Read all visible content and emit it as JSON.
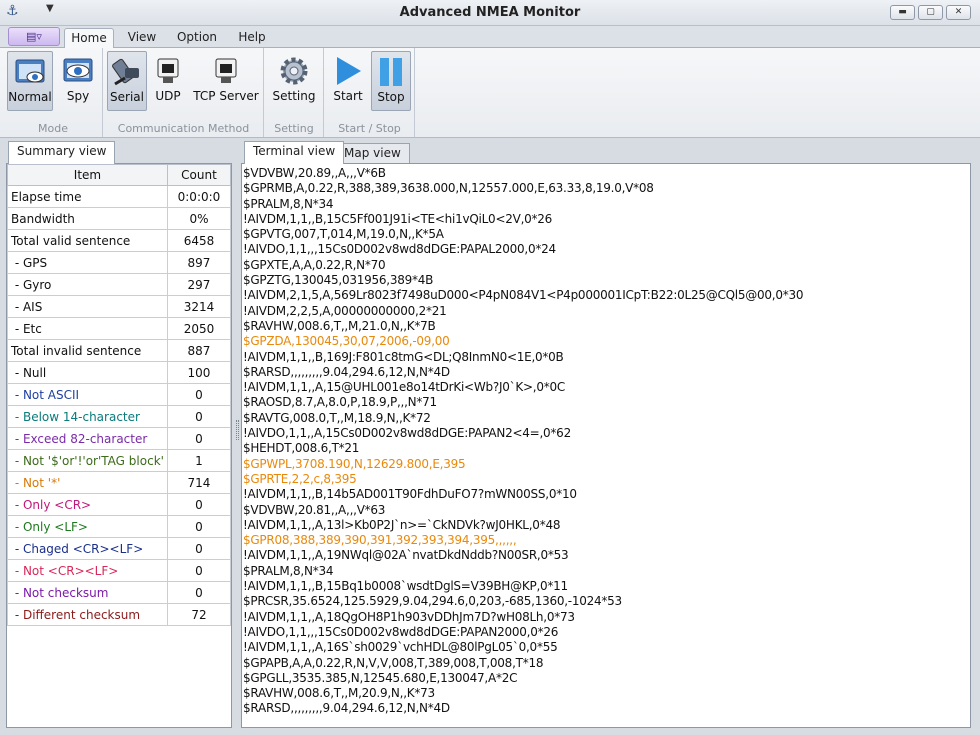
{
  "window": {
    "title": "Advanced NMEA Monitor",
    "icon": "anchor-icon",
    "controls": {
      "minimize": "▬",
      "maximize": "▢",
      "close": "✕"
    }
  },
  "menu_tabs": [
    "Home",
    "View",
    "Option",
    "Help"
  ],
  "ribbon": {
    "groups": [
      {
        "title": "Mode",
        "buttons": [
          "Normal",
          "Spy"
        ]
      },
      {
        "title": "Communication Method",
        "buttons": [
          "Serial",
          "UDP",
          "TCP Server"
        ]
      },
      {
        "title": "Setting",
        "buttons": [
          "Setting"
        ]
      },
      {
        "title": "Start / Stop",
        "buttons": [
          "Start",
          "Stop"
        ]
      }
    ]
  },
  "summary": {
    "tab_label": "Summary view",
    "headers": [
      "Item",
      "Count"
    ],
    "rows": [
      {
        "item": "Elapse time",
        "count": "0:0:0:0",
        "color": "#111111"
      },
      {
        "item": "Bandwidth",
        "count": "0%",
        "color": "#111111"
      },
      {
        "item": "Total valid sentence",
        "count": "6458",
        "color": "#111111"
      },
      {
        "item": " - GPS",
        "count": "897",
        "color": "#111111"
      },
      {
        "item": " - Gyro",
        "count": "297",
        "color": "#111111"
      },
      {
        "item": " - AIS",
        "count": "3214",
        "color": "#111111"
      },
      {
        "item": " - Etc",
        "count": "2050",
        "color": "#111111"
      },
      {
        "item": "Total invalid sentence",
        "count": "887",
        "color": "#111111"
      },
      {
        "item": " - Null",
        "count": "100",
        "color": "#111111"
      },
      {
        "item": " - Not ASCII",
        "count": "0",
        "color": "#1f3fa0"
      },
      {
        "item": " - Below 14-character",
        "count": "0",
        "color": "#0a7b7b"
      },
      {
        "item": " - Exceed 82-character",
        "count": "0",
        "color": "#7a2aa8"
      },
      {
        "item": " - Not '$'or'!'or'TAG block'",
        "count": "1",
        "color": "#3c6b1a"
      },
      {
        "item": " - Not '*'",
        "count": "714",
        "color": "#d47a0a"
      },
      {
        "item": " - Only <CR>",
        "count": "0",
        "color": "#c0187a"
      },
      {
        "item": " - Only <LF>",
        "count": "0",
        "color": "#1f7a1f"
      },
      {
        "item": " - Chaged <CR><LF>",
        "count": "0",
        "color": "#1a2f8a"
      },
      {
        "item": " - Not <CR><LF>",
        "count": "0",
        "color": "#d8285a"
      },
      {
        "item": " - Not checksum",
        "count": "0",
        "color": "#7a1aa8"
      },
      {
        "item": " - Different checksum",
        "count": "72",
        "color": "#8a1a1a"
      }
    ]
  },
  "terminal": {
    "tabs": [
      "Terminal view",
      "Map view"
    ],
    "normal_color": "#111111",
    "highlight_color": "#e8890c",
    "lines": [
      {
        "text": "$VDVBW,20.89,,A,,,V*6B",
        "hl": false
      },
      {
        "text": "$GPRMB,A,0.22,R,388,389,3638.000,N,12557.000,E,63.33,8,19.0,V*08",
        "hl": false
      },
      {
        "text": "$PRALM,8,N*34",
        "hl": false
      },
      {
        "text": "!AIVDM,1,1,,B,15C5Ff001J91i<TE<hi1vQiL0<2V,0*26",
        "hl": false
      },
      {
        "text": "$GPVTG,007,T,014,M,19.0,N,,K*5A",
        "hl": false
      },
      {
        "text": "!AIVDO,1,1,,,15Cs0D002v8wd8dDGE:PAPAL2000,0*24",
        "hl": false
      },
      {
        "text": "$GPXTE,A,A,0.22,R,N*70",
        "hl": false
      },
      {
        "text": "$GPZTG,130045,031956,389*4B",
        "hl": false
      },
      {
        "text": "!AIVDM,2,1,5,A,569Lr8023f7498uD000<P4pN084V1<P4p000001ICpT:B22:0L25@CQl5@00,0*30",
        "hl": false
      },
      {
        "text": "!AIVDM,2,2,5,A,00000000000,2*21",
        "hl": false
      },
      {
        "text": "$RAVHW,008.6,T,,M,21.0,N,,K*7B",
        "hl": false
      },
      {
        "text": "$GPZDA,130045,30,07,2006,-09,00",
        "hl": true
      },
      {
        "text": "!AIVDM,1,1,,B,169J:F801c8tmG<DL;Q8InmN0<1E,0*0B",
        "hl": false
      },
      {
        "text": "$RARSD,,,,,,,,,9.04,294.6,12,N,N*4D",
        "hl": false
      },
      {
        "text": "!AIVDM,1,1,,A,15@UHL001e8o14tDrKi<Wb?J0`K>,0*0C",
        "hl": false
      },
      {
        "text": "$RAOSD,8.7,A,8.0,P,18.9,P,,,N*71",
        "hl": false
      },
      {
        "text": "$RAVTG,008.0,T,,M,18.9,N,,K*72",
        "hl": false
      },
      {
        "text": "!AIVDO,1,1,,A,15Cs0D002v8wd8dDGE:PAPAN2<4=,0*62",
        "hl": false
      },
      {
        "text": "$HEHDT,008.6,T*21",
        "hl": false
      },
      {
        "text": "$GPWPL,3708.190,N,12629.800,E,395",
        "hl": true
      },
      {
        "text": "$GPRTE,2,2,c,8,395",
        "hl": true
      },
      {
        "text": "!AIVDM,1,1,,B,14b5AD001T90FdhDuFO7?mWN00SS,0*10",
        "hl": false
      },
      {
        "text": "$VDVBW,20.81,,A,,,V*63",
        "hl": false
      },
      {
        "text": "!AIVDM,1,1,,A,13l>Kb0P2J`n>=`CkNDVk?wJ0HKL,0*48",
        "hl": false
      },
      {
        "text": "$GPR08,388,389,390,391,392,393,394,395,,,,,,",
        "hl": true
      },
      {
        "text": "!AIVDM,1,1,,A,19NWql@02A`nvatDkdNddb?N00SR,0*53",
        "hl": false
      },
      {
        "text": "$PRALM,8,N*34",
        "hl": false
      },
      {
        "text": "!AIVDM,1,1,,B,15Bq1b0008`wsdtDglS=V39BH@KP,0*11",
        "hl": false
      },
      {
        "text": "$PRCSR,35.6524,125.5929,9.04,294.6,0,203,-685,1360,-1024*53",
        "hl": false
      },
      {
        "text": "!AIVDM,1,1,,A,18QgOH8P1h903vDDhJm7D?wH08Lh,0*73",
        "hl": false
      },
      {
        "text": "!AIVDO,1,1,,,15Cs0D002v8wd8dDGE:PAPAN2000,0*26",
        "hl": false
      },
      {
        "text": "!AIVDM,1,1,,A,16S`sh0029`vchHDL@80lPgL05`0,0*55",
        "hl": false
      },
      {
        "text": "$GPAPB,A,A,0.22,R,N,V,V,008,T,389,008,T,008,T*18",
        "hl": false
      },
      {
        "text": "$GPGLL,3535.385,N,12545.680,E,130047,A*2C",
        "hl": false
      },
      {
        "text": "$RAVHW,008.6,T,,M,20.9,N,,K*73",
        "hl": false
      },
      {
        "text": "$RARSD,,,,,,,,,9.04,294.6,12,N,N*4D",
        "hl": false
      }
    ]
  }
}
